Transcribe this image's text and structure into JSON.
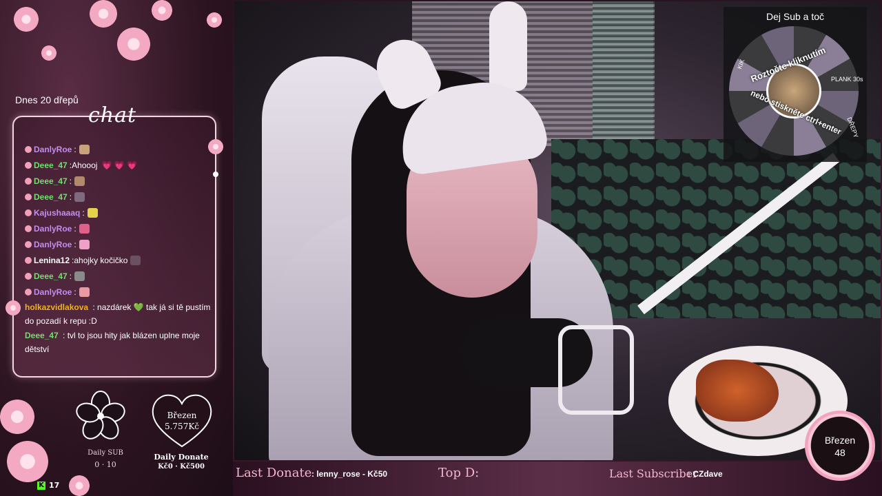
{
  "overlay": {
    "squats_text": "Dnes 20 dřepů",
    "chat_title": "chat",
    "chat": [
      {
        "user": "DanlyRoe",
        "sep": " :",
        "text": "",
        "user_color": "#c58cf0",
        "emote_color": "#c9a27a",
        "hearts": ""
      },
      {
        "user": "Deee_47",
        "sep": " :",
        "text": " Ahoooj",
        "user_color": "#6fe06a",
        "emote_color": "",
        "hearts": "💗 💗 💗"
      },
      {
        "user": "Deee_47",
        "sep": " :",
        "text": "",
        "user_color": "#6fe06a",
        "emote_color": "#b08a6a",
        "hearts": ""
      },
      {
        "user": "Deee_47",
        "sep": " :",
        "text": "",
        "user_color": "#6fe06a",
        "emote_color": "#7f6a80",
        "hearts": ""
      },
      {
        "user": "Kajushaaaq",
        "sep": " :",
        "text": "",
        "user_color": "#c58cf0",
        "emote_color": "#e6d24a",
        "hearts": ""
      },
      {
        "user": "DanlyRoe",
        "sep": " :",
        "text": "",
        "user_color": "#c58cf0",
        "emote_color": "#e0608a",
        "hearts": ""
      },
      {
        "user": "DanlyRoe",
        "sep": " :",
        "text": "",
        "user_color": "#c58cf0",
        "emote_color": "#f0a0c8",
        "hearts": ""
      },
      {
        "user": "Lenina12",
        "sep": " :",
        "text": " ahojky kočičko",
        "user_color": "#ffffff",
        "emote_color": "#6a5060",
        "hearts": ""
      },
      {
        "user": "Deee_47",
        "sep": " :",
        "text": "",
        "user_color": "#6fe06a",
        "emote_color": "#8a8a8a",
        "hearts": ""
      },
      {
        "user": "DanlyRoe",
        "sep": " :",
        "text": "",
        "user_color": "#c58cf0",
        "emote_color": "#e89aa0",
        "hearts": ""
      }
    ],
    "chat_multi": [
      {
        "user": "holkazvidlakova",
        "text": " : nazdárek 💚 tak já si tě pustím do pozadí k repu :D",
        "user_color": "#f0b020"
      },
      {
        "user": "Deee_47",
        "text": " : tvl to jsou hity jak blázen uplne moje dětství",
        "user_color": "#6fe06a"
      }
    ],
    "daily_sub": {
      "label": "Daily SUB",
      "count": "0 · 10"
    },
    "donate_heart": {
      "month": "Březen",
      "amount": "5.757Kč"
    },
    "daily_donate": {
      "label": "Daily Donate",
      "range": "Kč0 · Kč500"
    },
    "kick": {
      "count": "17"
    },
    "wheel": {
      "title": "Dej Sub a toč",
      "line1": "Roztočte kliknutím",
      "line2": "nebo stiskněte ctrl+enter",
      "segments": [
        "KIK",
        "PLANK 30s",
        "DŘEPY"
      ]
    },
    "bottom": {
      "last_donate_label": "Last Donate",
      "last_donate_value": ": lenny_rose - Kč50",
      "top_d_label": "Top D:",
      "last_sub_label": "Last Subscriber",
      "last_sub_value": ": CZdave"
    },
    "month_badge": {
      "name": "Březen",
      "number": "48"
    }
  },
  "colors": {
    "accent": "#f6b6d0",
    "frame": "#f4d6e3",
    "kick": "#53fc18"
  }
}
